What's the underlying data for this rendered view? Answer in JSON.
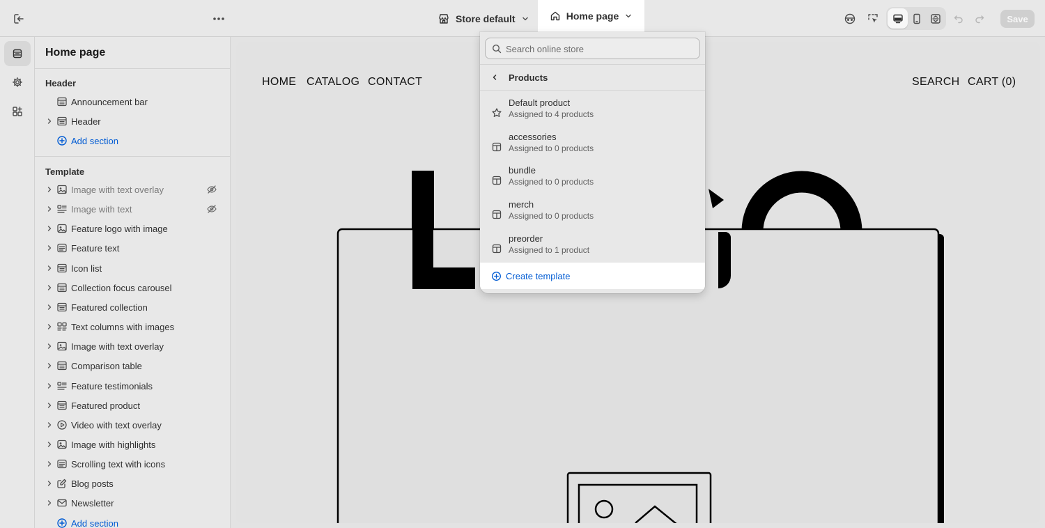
{
  "topbar": {
    "store_selector": "Store default",
    "page_selector": "Home page",
    "save_label": "Save"
  },
  "sidebar": {
    "title": "Home page",
    "header_group": {
      "label": "Header",
      "items": [
        {
          "label": "Announcement bar",
          "icon": "section-icon",
          "expandable": false
        },
        {
          "label": "Header",
          "icon": "section-icon",
          "expandable": true
        }
      ],
      "add_section": "Add section"
    },
    "template_group": {
      "label": "Template",
      "items": [
        {
          "label": "Image with text overlay",
          "icon": "image-text-icon",
          "hidden": true
        },
        {
          "label": "Image with text",
          "icon": "text-list-icon",
          "hidden": true
        },
        {
          "label": "Feature logo with image",
          "icon": "image-icon"
        },
        {
          "label": "Feature text",
          "icon": "text-block-icon"
        },
        {
          "label": "Icon list",
          "icon": "section-icon"
        },
        {
          "label": "Collection focus carousel",
          "icon": "section-icon"
        },
        {
          "label": "Featured collection",
          "icon": "section-icon"
        },
        {
          "label": "Text columns with images",
          "icon": "columns-icon"
        },
        {
          "label": "Image with text overlay",
          "icon": "image-text-icon"
        },
        {
          "label": "Comparison table",
          "icon": "section-icon"
        },
        {
          "label": "Feature testimonials",
          "icon": "text-list-icon"
        },
        {
          "label": "Featured product",
          "icon": "section-icon"
        },
        {
          "label": "Video with text overlay",
          "icon": "play-icon"
        },
        {
          "label": "Image with highlights",
          "icon": "image-icon"
        },
        {
          "label": "Scrolling text with icons",
          "icon": "text-block-icon"
        },
        {
          "label": "Blog posts",
          "icon": "edit-icon"
        },
        {
          "label": "Newsletter",
          "icon": "email-icon"
        }
      ],
      "add_section": "Add section"
    }
  },
  "preview": {
    "nav_left": [
      "HOME",
      "CATALOG",
      "CONTACT"
    ],
    "nav_right": [
      "SEARCH",
      "CART (0)"
    ]
  },
  "dropdown": {
    "search_placeholder": "Search online store",
    "back_label": "Products",
    "templates": [
      {
        "name": "Default product",
        "sub": "Assigned to 4 products",
        "icon": "star-icon"
      },
      {
        "name": "accessories",
        "sub": "Assigned to 0 products",
        "icon": "template-icon"
      },
      {
        "name": "bundle",
        "sub": "Assigned to 0 products",
        "icon": "template-icon"
      },
      {
        "name": "merch",
        "sub": "Assigned to 0 products",
        "icon": "template-icon"
      },
      {
        "name": "preorder",
        "sub": "Assigned to 1 product",
        "icon": "template-icon"
      }
    ],
    "create_label": "Create template"
  },
  "colors": {
    "link_blue": "#005bd3",
    "chrome_bg": "#e8e8e8",
    "preview_bg": "#e2e2e2"
  }
}
